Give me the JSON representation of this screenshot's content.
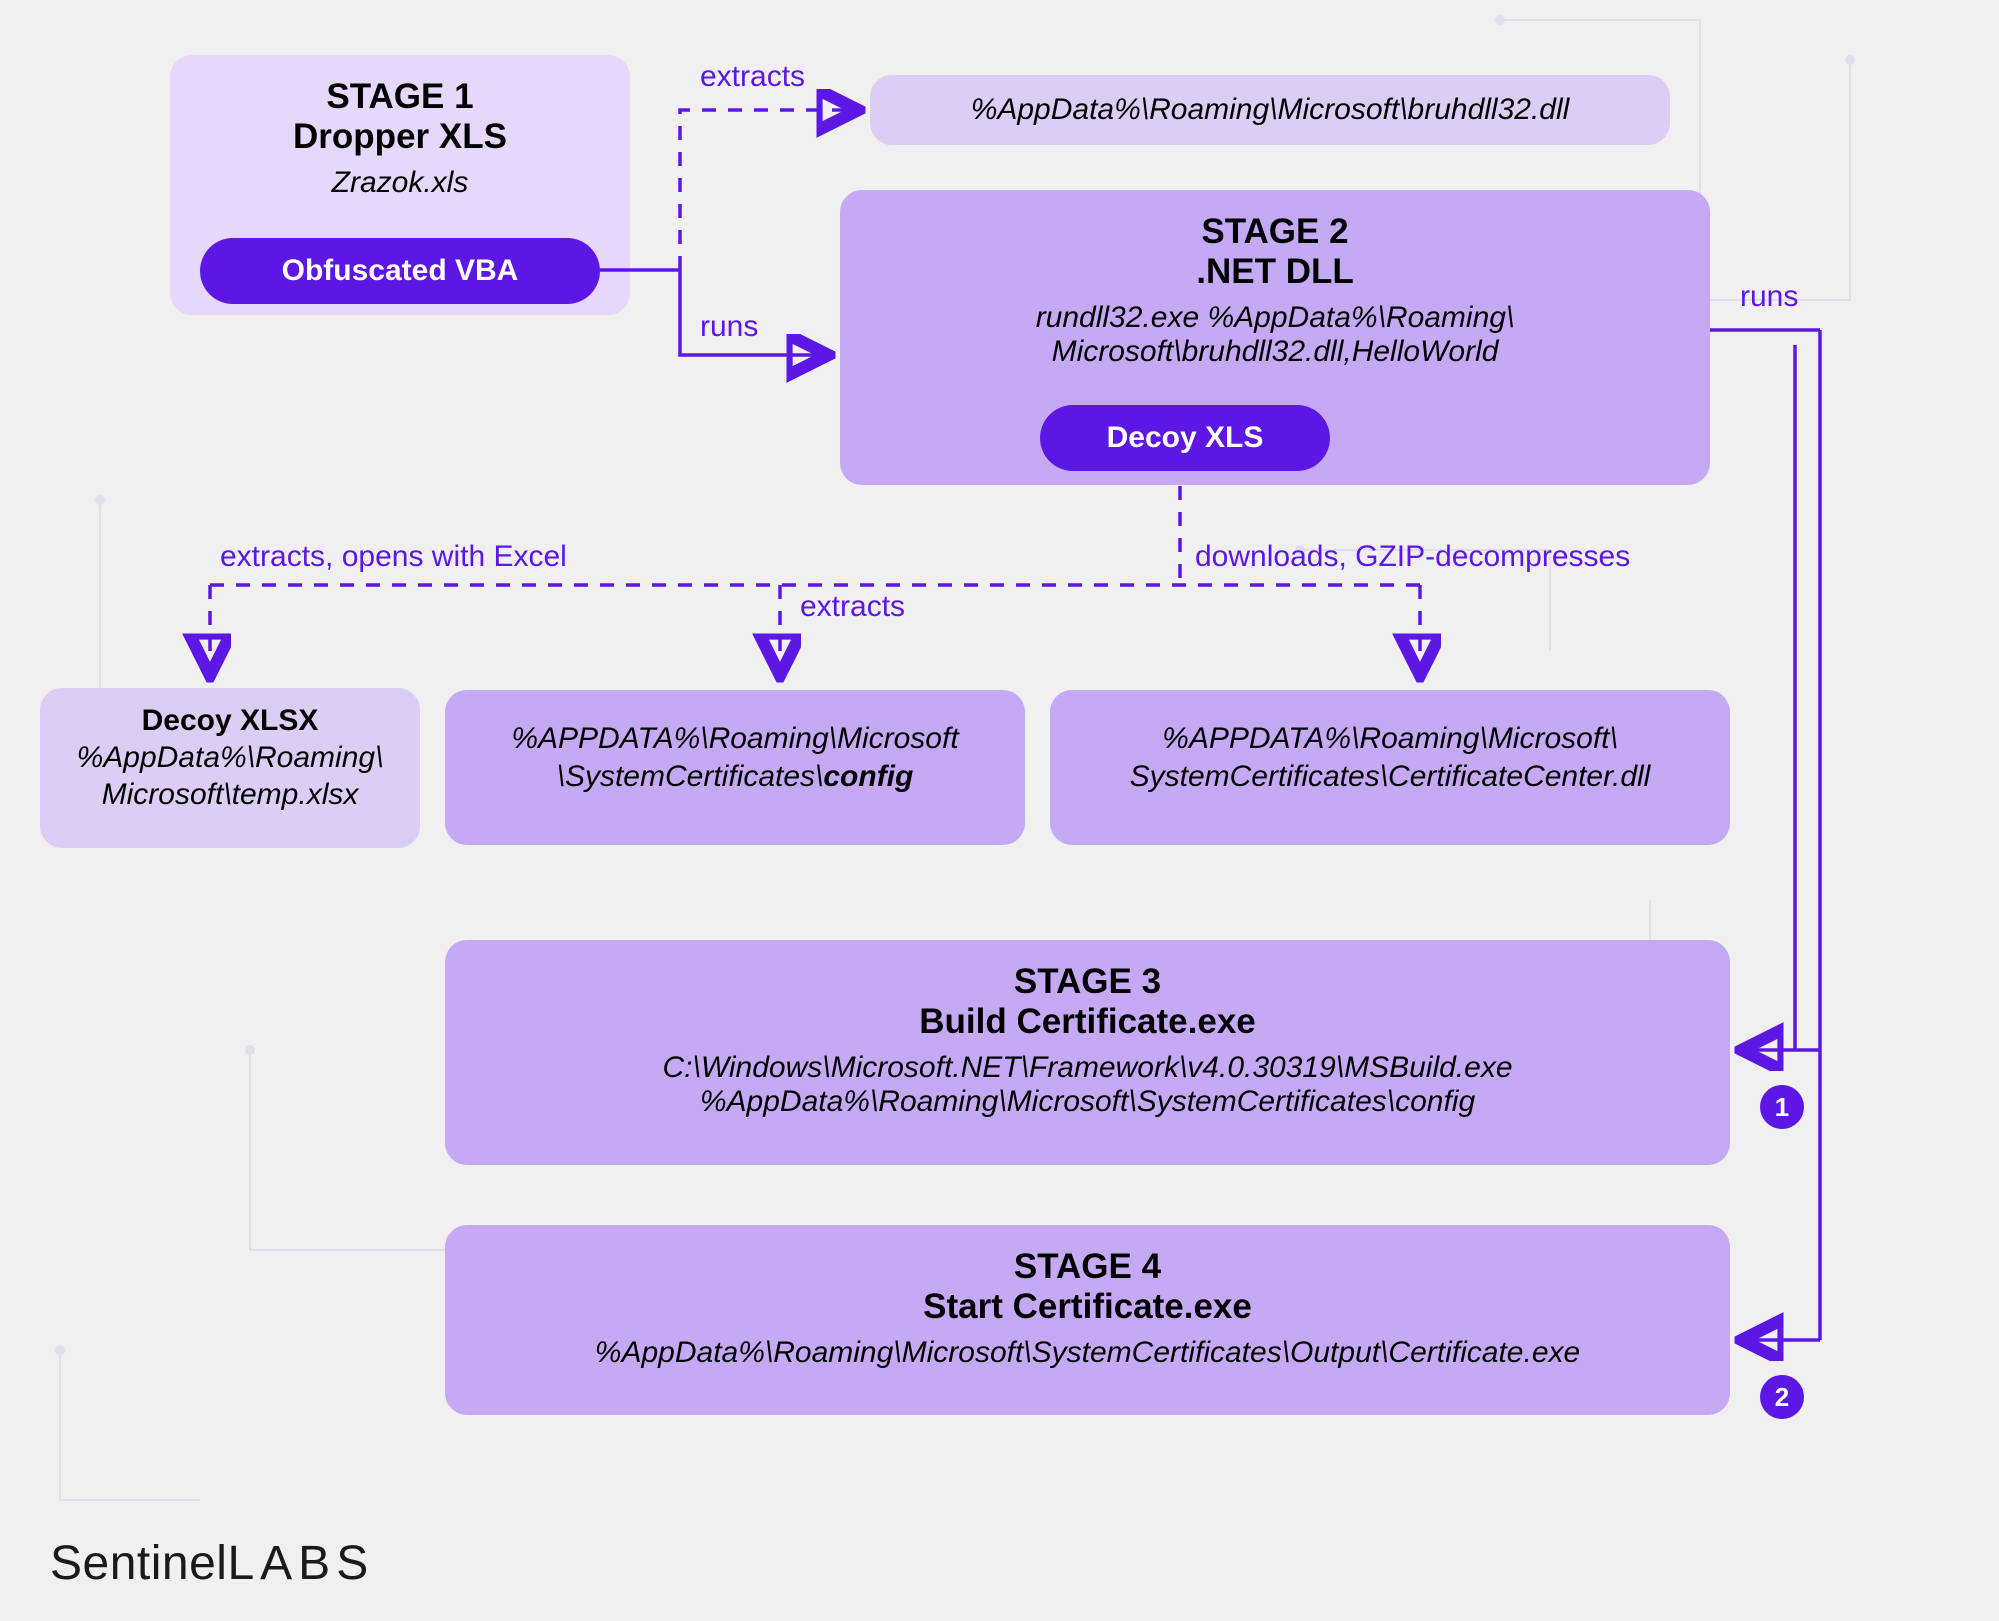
{
  "stage1": {
    "title_l1": "STAGE 1",
    "title_l2": "Dropper XLS",
    "sub": "Zrazok.xls",
    "pill": "Obfuscated VBA"
  },
  "stage1_out": {
    "path": "%AppData%\\Roaming\\Microsoft\\bruhdll32.dll"
  },
  "edge_extracts": "extracts",
  "edge_runs": "runs",
  "stage2": {
    "title_l1": "STAGE 2",
    "title_l2": ".NET DLL",
    "sub_l1": "rundll32.exe %AppData%\\Roaming\\",
    "sub_l2": "Microsoft\\bruhdll32.dll,HelloWorld",
    "pill": "Decoy XLS"
  },
  "edge_runs_right": "runs",
  "edge_extracts_opens": "extracts, opens with Excel",
  "edge_extracts2": "extracts",
  "edge_downloads": "downloads, GZIP-decompresses",
  "decoy_xlsx": {
    "title": "Decoy XLSX",
    "path_l1": "%AppData%\\Roaming\\",
    "path_l2": "Microsoft\\temp.xlsx"
  },
  "config_box": {
    "path_l1": "%APPDATA%\\Roaming\\Microsoft",
    "path_l2_pre": "\\SystemCertificates\\",
    "path_l2_bold": "config"
  },
  "certdll_box": {
    "path_l1": "%APPDATA%\\Roaming\\Microsoft\\",
    "path_l2": "SystemCertificates\\CertificateCenter.dll"
  },
  "stage3": {
    "title_l1": "STAGE 3",
    "title_l2": "Build Certificate.exe",
    "path_l1": "C:\\Windows\\Microsoft.NET\\Framework\\v4.0.30319\\MSBuild.exe",
    "path_l2": "%AppData%\\Roaming\\Microsoft\\SystemCertificates\\config"
  },
  "stage4": {
    "title_l1": "STAGE 4",
    "title_l2": "Start Certificate.exe",
    "path": "%AppData%\\Roaming\\Microsoft\\SystemCertificates\\Output\\Certificate.exe"
  },
  "badge1": "1",
  "badge2": "2",
  "logo_thin": "Sentinel",
  "logo_bold": "LABS"
}
